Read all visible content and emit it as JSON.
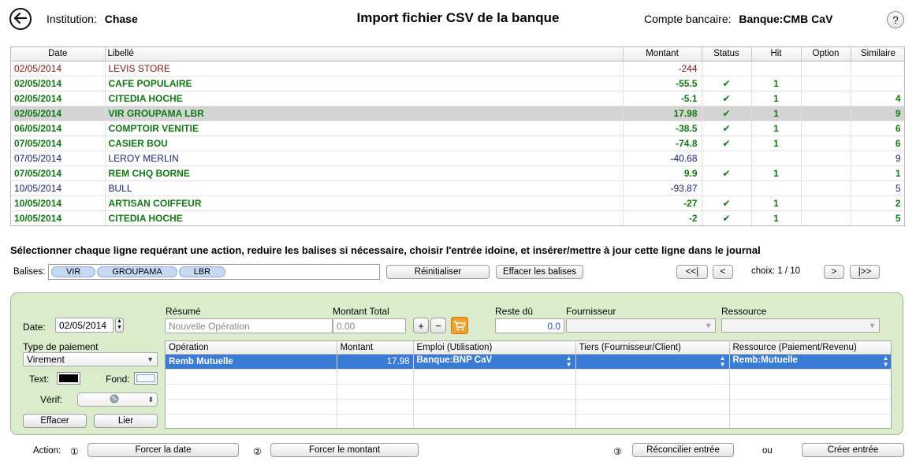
{
  "header": {
    "institution_label": "Institution:",
    "institution_value": "Chase",
    "title": "Import fichier CSV de la banque",
    "account_label": "Compte bancaire:",
    "account_value": "Banque:CMB CaV",
    "help": "?"
  },
  "table": {
    "columns": [
      "Date",
      "Libellé",
      "Montant",
      "Status",
      "Hit",
      "Option",
      "Similaire"
    ],
    "rows": [
      {
        "date": "02/05/2014",
        "label": "LEVIS STORE",
        "amount": "-244",
        "status": "",
        "hit": "",
        "option": "",
        "similar": "",
        "color": "red"
      },
      {
        "date": "02/05/2014",
        "label": "CAFE POPULAIRE",
        "amount": "-55.5",
        "status": "✔",
        "hit": "1",
        "option": "",
        "similar": "",
        "color": "green"
      },
      {
        "date": "02/05/2014",
        "label": "CITEDIA HOCHE",
        "amount": "-5.1",
        "status": "✔",
        "hit": "1",
        "option": "",
        "similar": "4",
        "color": "green"
      },
      {
        "date": "02/05/2014",
        "label": "VIR GROUPAMA LBR",
        "amount": "17.98",
        "status": "✔",
        "hit": "1",
        "option": "",
        "similar": "9",
        "color": "green",
        "selected": true
      },
      {
        "date": "06/05/2014",
        "label": "COMPTOIR VENITIE",
        "amount": "-38.5",
        "status": "✔",
        "hit": "1",
        "option": "",
        "similar": "6",
        "color": "green"
      },
      {
        "date": "07/05/2014",
        "label": "CASIER BOU",
        "amount": "-74.8",
        "status": "✔",
        "hit": "1",
        "option": "",
        "similar": "6",
        "color": "green"
      },
      {
        "date": "07/05/2014",
        "label": "LEROY MERLIN",
        "amount": "-40.68",
        "status": "",
        "hit": "",
        "option": "",
        "similar": "9",
        "color": "blue"
      },
      {
        "date": "07/05/2014",
        "label": "REM CHQ BORNE",
        "amount": "9.9",
        "status": "✔",
        "hit": "1",
        "option": "",
        "similar": "1",
        "color": "green"
      },
      {
        "date": "10/05/2014",
        "label": "BULL",
        "amount": "-93.87",
        "status": "",
        "hit": "",
        "option": "",
        "similar": "5",
        "color": "blue"
      },
      {
        "date": "10/05/2014",
        "label": "ARTISAN COIFFEUR",
        "amount": "-27",
        "status": "✔",
        "hit": "1",
        "option": "",
        "similar": "2",
        "color": "green"
      },
      {
        "date": "10/05/2014",
        "label": "CITEDIA HOCHE",
        "amount": "-2",
        "status": "✔",
        "hit": "1",
        "option": "",
        "similar": "5",
        "color": "green"
      }
    ]
  },
  "instruction": "Sélectionner chaque ligne requérant une action, reduire les balises si nécessaire, choisir l'entrée idoine, et insérer/mettre à jour cette ligne dans le journal",
  "balises": {
    "label": "Balises:",
    "tags": [
      "VIR",
      "GROUPAMA",
      "LBR"
    ],
    "reset_button": "Réinitialiser",
    "clear_button": "Effacer les balises"
  },
  "nav": {
    "first": "<<|",
    "prev": "<",
    "choix_label": "choix:",
    "choix_value": "1 / 10",
    "next": ">",
    "last": "|>>"
  },
  "panel": {
    "date_label": "Date:",
    "date_value": "02/05/2014",
    "payment_type_label": "Type de paiement",
    "payment_type_value": "Virement",
    "text_label": "Text:",
    "fond_label": "Fond:",
    "verif_label": "Vérif:",
    "effacer_button": "Effacer",
    "lier_button": "Lier",
    "resume_label": "Résumé",
    "resume_placeholder": "Nouvelle Opération",
    "montant_total_label": "Montant Total",
    "montant_total_placeholder": "0.00",
    "plus": "+",
    "minus": "−",
    "reste_du_label": "Reste dû",
    "reste_du_value": "0.0",
    "fournisseur_label": "Fournisseur",
    "ressource_label": "Ressource"
  },
  "split": {
    "columns": [
      "Opération",
      "Montant",
      "Emploi (Utilisation)",
      "Tiers (Fournisseur/Client)",
      "Ressource (Paiement/Revenu)"
    ],
    "rows": [
      {
        "operation": "Remb Mutuelle",
        "amount": "17.98",
        "emploi": "Banque:BNP CaV",
        "tiers": "",
        "ressource": "Remb:Mutuelle"
      }
    ],
    "empty_rows": 4
  },
  "actions": {
    "label": "Action:",
    "step1": "①",
    "force_date": "Forcer la date",
    "step2": "②",
    "force_amount": "Forcer le montant",
    "step3": "③",
    "reconcile": "Réconcilier entrée",
    "ou": "ou",
    "create": "Créer entrée"
  },
  "colors": {
    "green_text": "#0f7a12",
    "blue_text": "#1a237e",
    "red_text": "#8a1111",
    "panel_bg": "#dbeccd",
    "selection_blue": "#3a7bd5"
  }
}
